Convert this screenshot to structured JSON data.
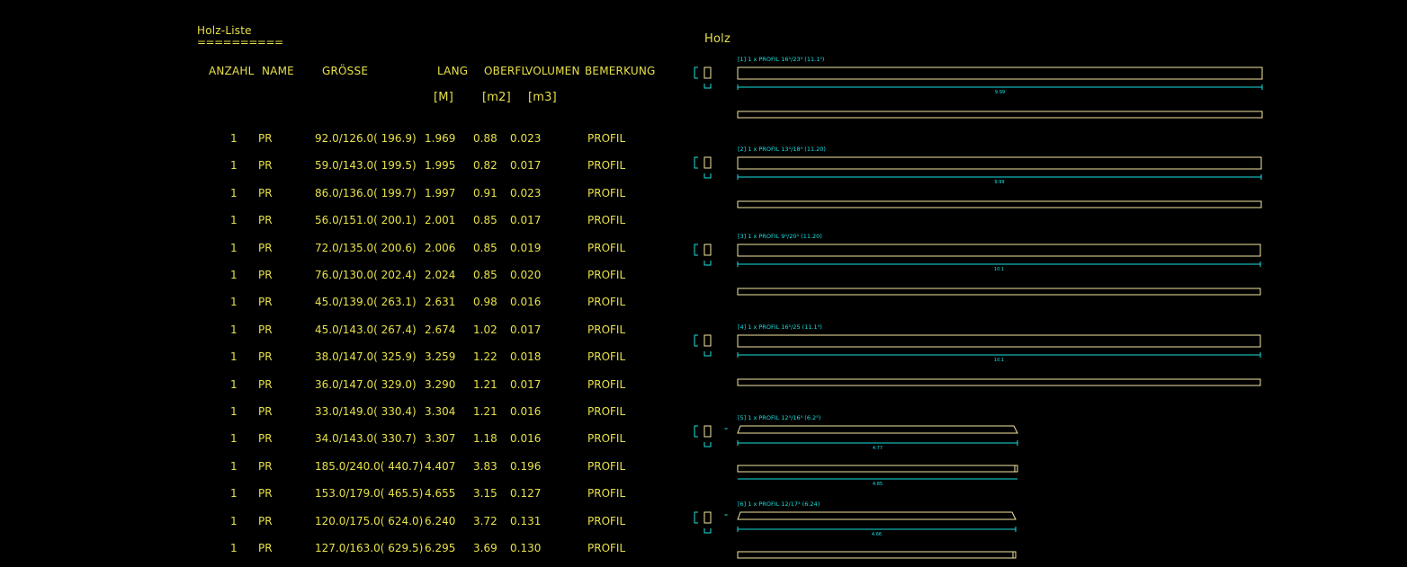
{
  "list": {
    "title": "Holz-Liste",
    "underline": "==========",
    "headers": {
      "anzahl": "ANZAHL",
      "name": "NAME",
      "groesse": "GRÖSSE",
      "lang": "LANG",
      "oberfl": "OBERFL",
      "volumen": "VOLUMEN",
      "bemerkung": "BEMERKUNG"
    },
    "units": {
      "lang": "[M]",
      "oberfl": "[m2]",
      "volumen": "[m3]"
    },
    "rows": [
      {
        "anzahl": "1",
        "name": "PR",
        "groesse": "92.0/126.0( 196.9)",
        "lang": "1.969",
        "oberfl": "0.88",
        "volumen": "0.023",
        "bemerkung": "PROFIL"
      },
      {
        "anzahl": "1",
        "name": "PR",
        "groesse": "59.0/143.0( 199.5)",
        "lang": "1.995",
        "oberfl": "0.82",
        "volumen": "0.017",
        "bemerkung": "PROFIL"
      },
      {
        "anzahl": "1",
        "name": "PR",
        "groesse": "86.0/136.0( 199.7)",
        "lang": "1.997",
        "oberfl": "0.91",
        "volumen": "0.023",
        "bemerkung": "PROFIL"
      },
      {
        "anzahl": "1",
        "name": "PR",
        "groesse": "56.0/151.0( 200.1)",
        "lang": "2.001",
        "oberfl": "0.85",
        "volumen": "0.017",
        "bemerkung": "PROFIL"
      },
      {
        "anzahl": "1",
        "name": "PR",
        "groesse": "72.0/135.0( 200.6)",
        "lang": "2.006",
        "oberfl": "0.85",
        "volumen": "0.019",
        "bemerkung": "PROFIL"
      },
      {
        "anzahl": "1",
        "name": "PR",
        "groesse": "76.0/130.0( 202.4)",
        "lang": "2.024",
        "oberfl": "0.85",
        "volumen": "0.020",
        "bemerkung": "PROFIL"
      },
      {
        "anzahl": "1",
        "name": "PR",
        "groesse": "45.0/139.0( 263.1)",
        "lang": "2.631",
        "oberfl": "0.98",
        "volumen": "0.016",
        "bemerkung": "PROFIL"
      },
      {
        "anzahl": "1",
        "name": "PR",
        "groesse": "45.0/143.0( 267.4)",
        "lang": "2.674",
        "oberfl": "1.02",
        "volumen": "0.017",
        "bemerkung": "PROFIL"
      },
      {
        "anzahl": "1",
        "name": "PR",
        "groesse": "38.0/147.0( 325.9)",
        "lang": "3.259",
        "oberfl": "1.22",
        "volumen": "0.018",
        "bemerkung": "PROFIL"
      },
      {
        "anzahl": "1",
        "name": "PR",
        "groesse": "36.0/147.0( 329.0)",
        "lang": "3.290",
        "oberfl": "1.21",
        "volumen": "0.017",
        "bemerkung": "PROFIL"
      },
      {
        "anzahl": "1",
        "name": "PR",
        "groesse": "33.0/149.0( 330.4)",
        "lang": "3.304",
        "oberfl": "1.21",
        "volumen": "0.016",
        "bemerkung": "PROFIL"
      },
      {
        "anzahl": "1",
        "name": "PR",
        "groesse": "34.0/143.0( 330.7)",
        "lang": "3.307",
        "oberfl": "1.18",
        "volumen": "0.016",
        "bemerkung": "PROFIL"
      },
      {
        "anzahl": "1",
        "name": "PR",
        "groesse": "185.0/240.0( 440.7)",
        "lang": "4.407",
        "oberfl": "3.83",
        "volumen": "0.196",
        "bemerkung": "PROFIL"
      },
      {
        "anzahl": "1",
        "name": "PR",
        "groesse": "153.0/179.0( 465.5)",
        "lang": "4.655",
        "oberfl": "3.15",
        "volumen": "0.127",
        "bemerkung": "PROFIL"
      },
      {
        "anzahl": "1",
        "name": "PR",
        "groesse": "120.0/175.0( 624.0)",
        "lang": "6.240",
        "oberfl": "3.72",
        "volumen": "0.131",
        "bemerkung": "PROFIL"
      },
      {
        "anzahl": "1",
        "name": "PR",
        "groesse": "127.0/163.0( 629.5)",
        "lang": "6.295",
        "oberfl": "3.69",
        "volumen": "0.130",
        "bemerkung": "PROFIL"
      }
    ]
  },
  "drawing": {
    "title": "Holz",
    "colors": {
      "beam": "#f5e6a0",
      "dim": "#18e0e0",
      "text": "#e6e04a",
      "background": "#000000"
    },
    "parts": [
      {
        "label": "[1] 1 x PROFIL 16⁵/23⁰ (11.1⁵)",
        "dim_text": "9.99"
      },
      {
        "label": "[2] 1 x PROFIL 13⁵/18⁵ (11.20)",
        "dim_text": "9.99"
      },
      {
        "label": "[3] 1 x PROFIL 9⁵/20⁵ (11.20)",
        "dim_text": "10.1"
      },
      {
        "label": "[4] 1 x PROFIL 16⁵/25 (11.1⁵)",
        "dim_text": "10.1"
      },
      {
        "label": "[5] 1 x PROFIL 12⁵/16⁵ (6.2⁵)",
        "dim_text": "4.77",
        "dim_text2": "4.85"
      },
      {
        "label": "[6] 1 x PROFIL 12/17⁵ (6.24)",
        "dim_text": "4.66"
      }
    ]
  }
}
